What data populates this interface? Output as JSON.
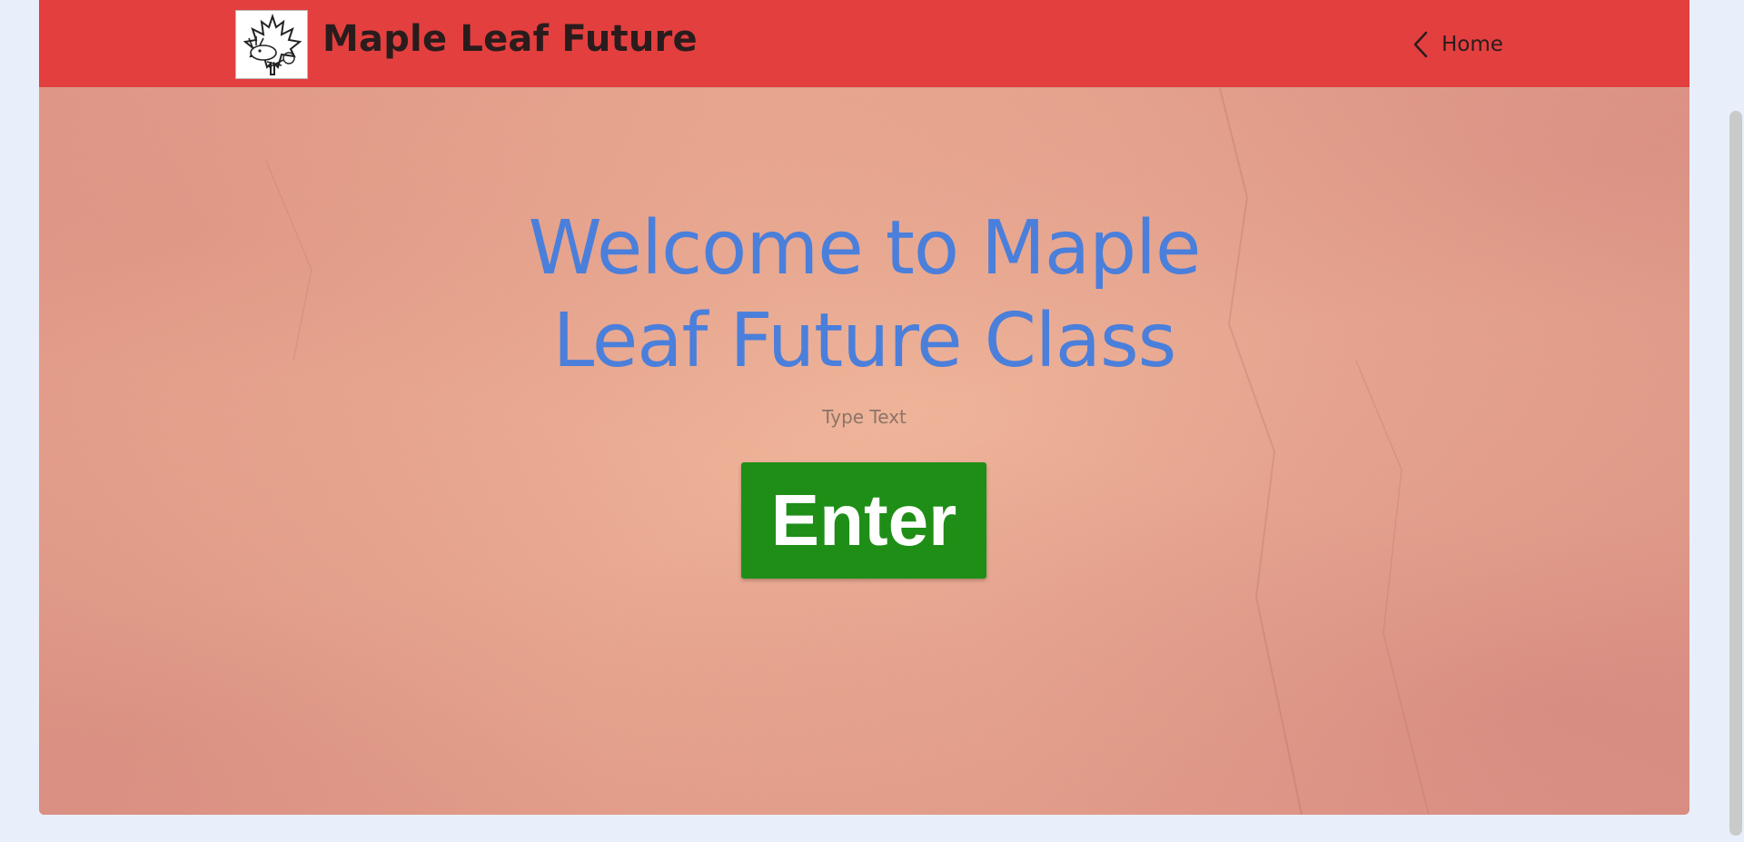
{
  "header": {
    "site_title": "Maple Leaf Future",
    "home_label": "Home",
    "background_color": "#e33f3f"
  },
  "hero": {
    "title_line1": "Welcome to Maple",
    "title_line2": "Leaf Future Class",
    "subtext": "Type Text",
    "enter_button_label": "Enter",
    "title_color": "#4a7fdb",
    "button_color": "#1f8e17"
  },
  "icons": {
    "logo": "maple-leaf-moose-logo",
    "back": "chevron-left-icon"
  }
}
